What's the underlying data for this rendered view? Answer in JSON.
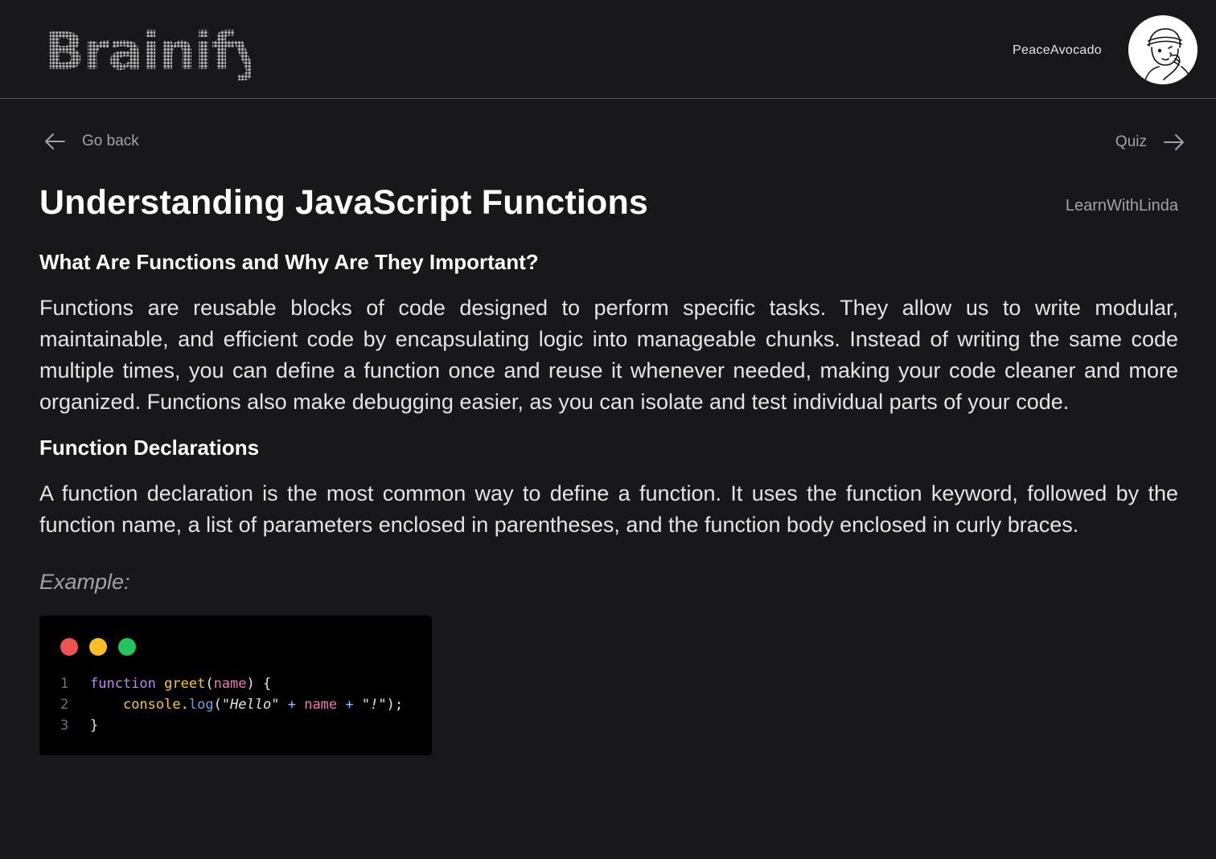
{
  "app": {
    "logo_text": "Brainify",
    "username": "PeaceAvocado"
  },
  "nav": {
    "back_label": "Go back",
    "next_label": "Quiz"
  },
  "article": {
    "title": "Understanding JavaScript Functions",
    "author": "LearnWithLinda",
    "sections": [
      {
        "heading": "What Are Functions and Why Are They Important?",
        "body": "Functions are reusable blocks of code designed to perform specific tasks. They allow us to write modular, maintainable, and efficient code by encapsulating logic into manageable chunks. Instead of writing the same code multiple times, you can define a function once and reuse it whenever needed, making your code cleaner and more organized. Functions also make debugging easier, as you can isolate and test individual parts of your code."
      },
      {
        "heading": "Function Declarations",
        "body": "A function declaration is the most common way to define a function. It uses the function keyword, followed by the function name, a list of parameters enclosed in parentheses, and the function body enclosed in curly braces."
      }
    ],
    "example_label": "Example:"
  },
  "code_example": {
    "line_numbers": [
      "1",
      "2",
      "3"
    ],
    "line1": {
      "kw": "function",
      "fn": "greet",
      "open": "(",
      "param": "name",
      "close": ") {"
    },
    "line2": {
      "indent": "    ",
      "obj": "console",
      "dot": ".",
      "method": "log",
      "open": "(",
      "str1": "\"Hello\"",
      "plus1": " + ",
      "var": "name",
      "plus2": " + ",
      "str2": "\"!\"",
      "close": ");"
    },
    "line3": {
      "text": "}"
    }
  },
  "colors": {
    "background": "#18181b",
    "dot_red": "#ef5350",
    "dot_yellow": "#fbbf24",
    "dot_green": "#22c55e"
  },
  "icons": {
    "back": "arrow-left-icon",
    "next": "arrow-right-icon",
    "avatar": "avatar-illustration"
  }
}
